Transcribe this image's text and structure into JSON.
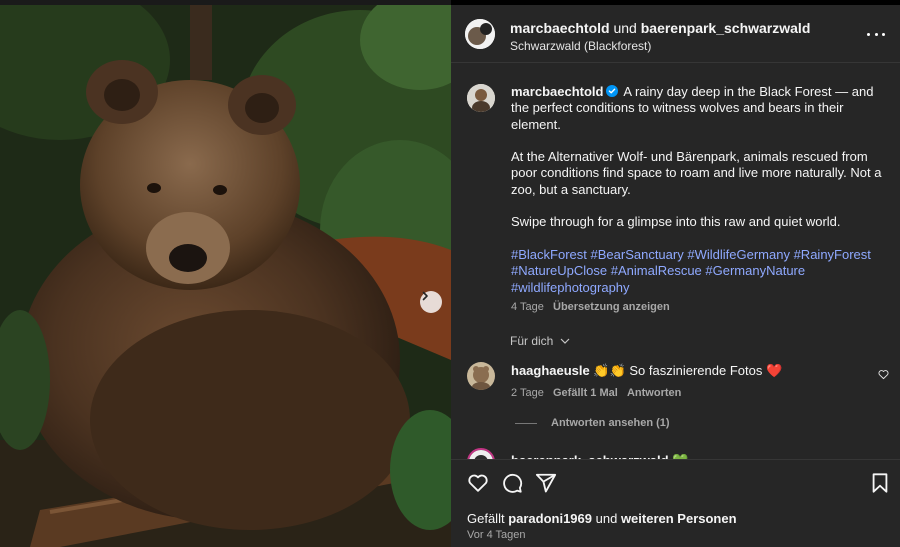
{
  "post": {
    "author": "marcbaechtold",
    "connector": " und ",
    "collaborator": "baerenpark_schwarzwald",
    "location": "Schwarzwald (Blackforest)"
  },
  "caption": {
    "username": "marcbaechtold",
    "line1": "A rainy day deep in the Black Forest — and the perfect conditions to witness wolves and bears in their element.",
    "line2": "At the Alternativer Wolf- und Bärenpark, animals rescued from poor conditions find space to roam and live more naturally. Not a zoo, but a sanctuary.",
    "line3": "Swipe through for a glimpse into this raw and quiet world.",
    "hashtags": [
      "#BlackForest",
      "#BearSanctuary",
      "#WildlifeGermany",
      "#RainyForest",
      "#NatureUpClose",
      "#AnimalRescue",
      "#GermanyNature",
      "#wildlifephotography"
    ],
    "age": "4 Tage",
    "translate": "Übersetzung anzeigen"
  },
  "for_you": "Für dich",
  "comments": [
    {
      "username": "haaghaeusle",
      "text": "👏👏 So faszinierende Fotos ❤️",
      "age": "2 Tage",
      "likes": "Gefällt 1 Mal",
      "reply": "Antworten",
      "view_replies": "Antworten ansehen (1)"
    },
    {
      "username": "baerenpark_schwarzwald",
      "text": "💚"
    }
  ],
  "footer": {
    "likes_prefix": "Gefällt ",
    "liked_by": "paradoni1969",
    "likes_middle": " und ",
    "likes_suffix": "weiteren Personen",
    "date": "Vor 4 Tagen"
  },
  "icons": {
    "like": "heart-icon",
    "comment": "comment-icon",
    "share": "paper-plane-icon",
    "save": "bookmark-icon",
    "more": "more-horizontal-icon",
    "next": "chevron-right-icon",
    "verified": "verified-badge-icon"
  },
  "colors": {
    "panel_bg": "#262626",
    "hashtag": "#8fa9ff",
    "verified": "#0095f6",
    "muted": "#a8a8a8"
  }
}
